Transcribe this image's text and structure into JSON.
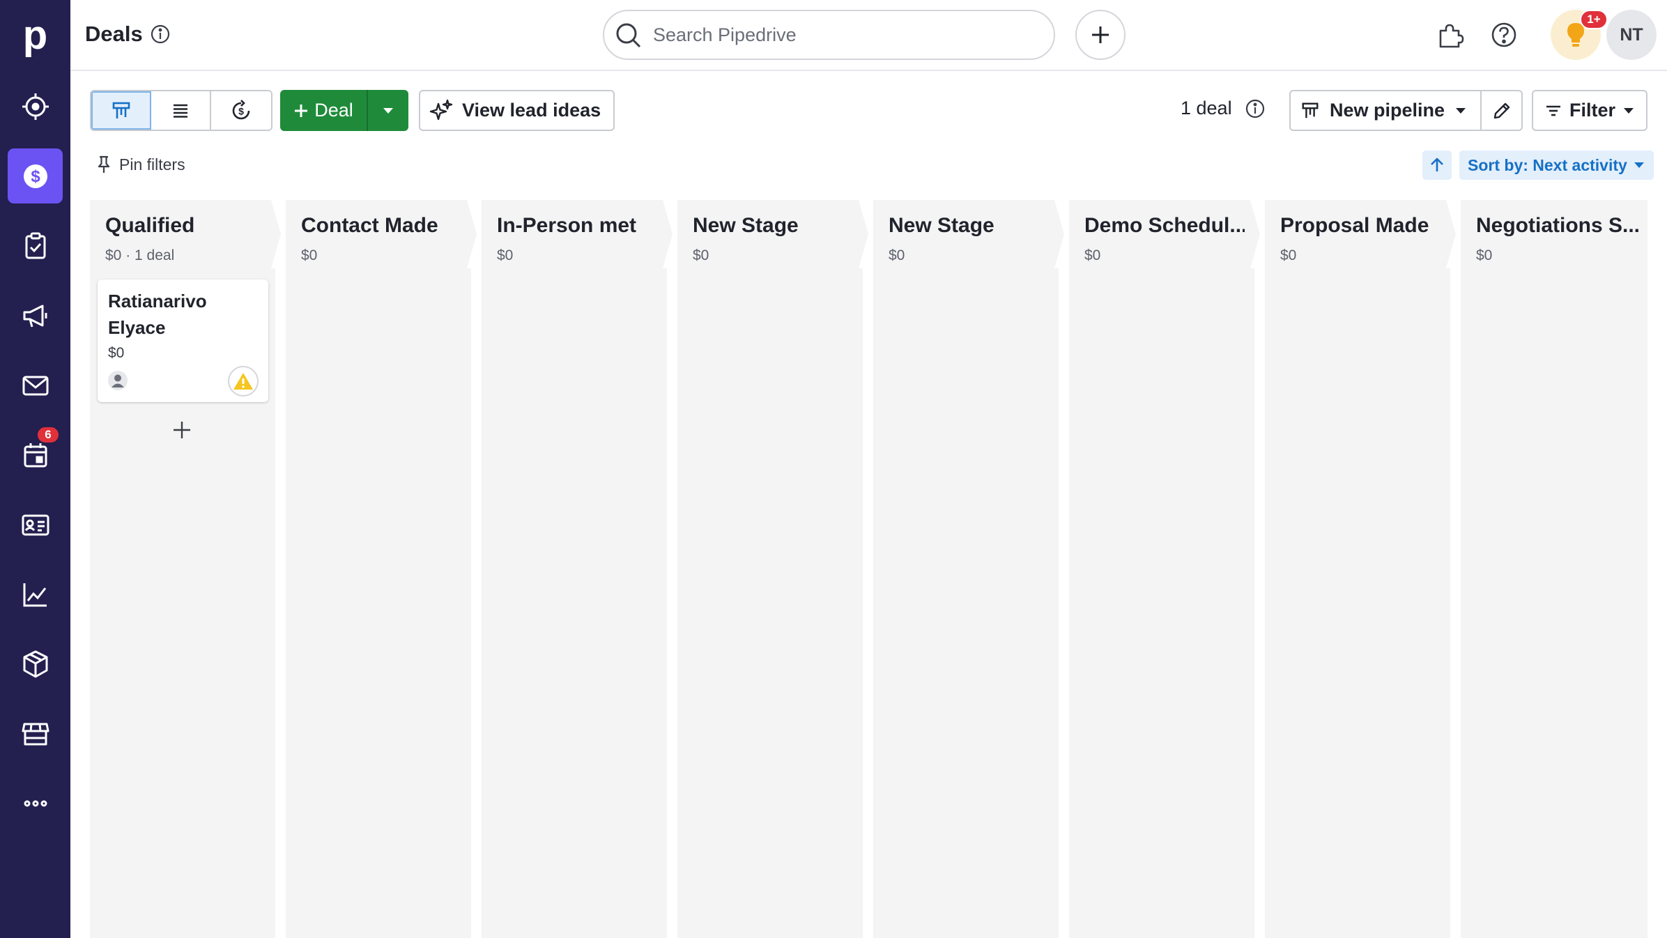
{
  "app": {
    "logo_letter": "p",
    "page_title": "Deals",
    "search_placeholder": "Search Pipedrive",
    "notification_badge": "1+",
    "user_initials": "NT"
  },
  "sidebar": {
    "items": [
      {
        "name": "leads",
        "icon": "target-icon"
      },
      {
        "name": "deals",
        "icon": "dollar-icon",
        "active": true
      },
      {
        "name": "activities",
        "icon": "clipboard-icon"
      },
      {
        "name": "campaigns",
        "icon": "megaphone-icon"
      },
      {
        "name": "mail",
        "icon": "mail-icon"
      },
      {
        "name": "calendar",
        "icon": "calendar-icon",
        "badge": "6"
      },
      {
        "name": "contacts",
        "icon": "contact-card-icon"
      },
      {
        "name": "insights",
        "icon": "chart-icon"
      },
      {
        "name": "products",
        "icon": "box-icon"
      },
      {
        "name": "marketplace",
        "icon": "store-icon"
      },
      {
        "name": "more",
        "icon": "more-icon"
      }
    ]
  },
  "toolbar": {
    "deal_label": "Deal",
    "lead_ideas_label": "View lead ideas",
    "deal_count": "1 deal",
    "pipeline_label": "New pipeline",
    "filter_label": "Filter",
    "pin_filters_label": "Pin filters",
    "sort_label": "Sort by: Next activity"
  },
  "stages": [
    {
      "name": "Qualified",
      "summary": "$0 · 1 deal"
    },
    {
      "name": "Contact Made",
      "summary": "$0"
    },
    {
      "name": "In-Person met",
      "summary": "$0"
    },
    {
      "name": "New Stage",
      "summary": "$0"
    },
    {
      "name": "New Stage",
      "summary": "$0"
    },
    {
      "name": "Demo Schedul...",
      "summary": "$0"
    },
    {
      "name": "Proposal Made",
      "summary": "$0"
    },
    {
      "name": "Negotiations S...",
      "summary": "$0"
    }
  ],
  "deal_card": {
    "title": "Ratianarivo Elyace",
    "value": "$0"
  },
  "colors": {
    "sidebar": "#231f4f",
    "active_nav": "#6b53f3",
    "primary_green": "#1f8b3a",
    "link_blue": "#1670c6",
    "badge_red": "#e0303a"
  }
}
